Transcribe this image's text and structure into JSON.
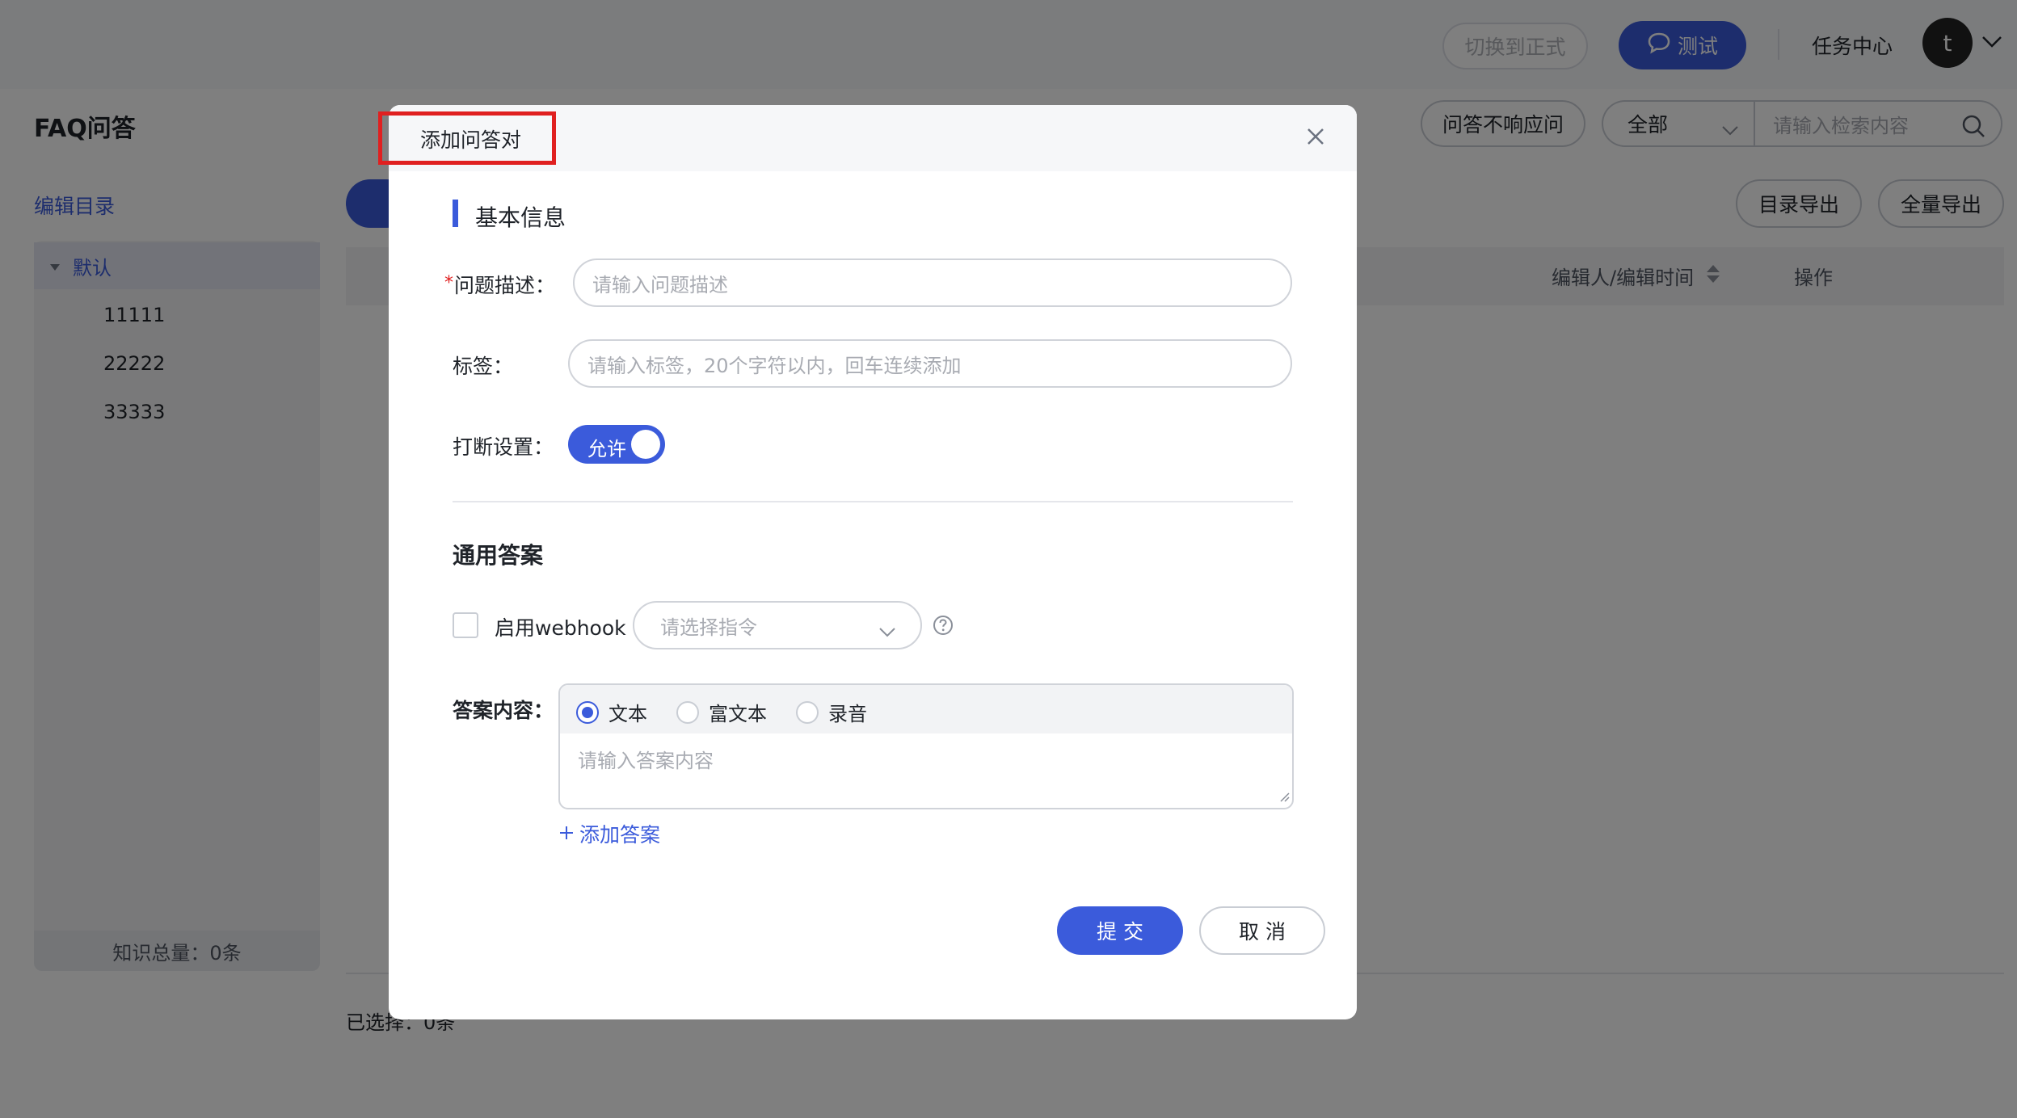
{
  "topbar": {
    "switch_label": "切换到正式",
    "test_label": "测试",
    "task_center": "任务中心",
    "avatar_letter": "t"
  },
  "page": {
    "title": "FAQ问答",
    "edit_catalog": "编辑目录",
    "no_response_btn": "问答不响应问",
    "filter_value": "全部",
    "search_placeholder": "请输入检索内容",
    "catalog_export": "目录导出",
    "full_export": "全量导出",
    "col_editor_time": "编辑人/编辑时间",
    "col_action": "操作",
    "selected_text": "已选择：0条"
  },
  "sidebar": {
    "root": "默认",
    "items": [
      "11111",
      "22222",
      "33333"
    ],
    "total": "知识总量：0条"
  },
  "modal": {
    "title": "添加问答对",
    "section_basic": "基本信息",
    "question_label": "问题描述：",
    "question_placeholder": "请输入问题描述",
    "tag_label": "标签：",
    "tag_placeholder": "请输入标签，20个字符以内，回车连续添加",
    "interrupt_label": "打断设置：",
    "interrupt_toggle": "允许",
    "section_answer": "通用答案",
    "webhook_label": "启用webhook",
    "command_placeholder": "请选择指令",
    "answer_label": "答案内容：",
    "answer_types": [
      "文本",
      "富文本",
      "录音"
    ],
    "answer_placeholder": "请输入答案内容",
    "add_answer": "添加答案",
    "submit": "提 交",
    "cancel": "取 消"
  },
  "colors": {
    "accent": "#3b5bdb",
    "highlight_box": "#e02020",
    "required": "#e02020"
  }
}
